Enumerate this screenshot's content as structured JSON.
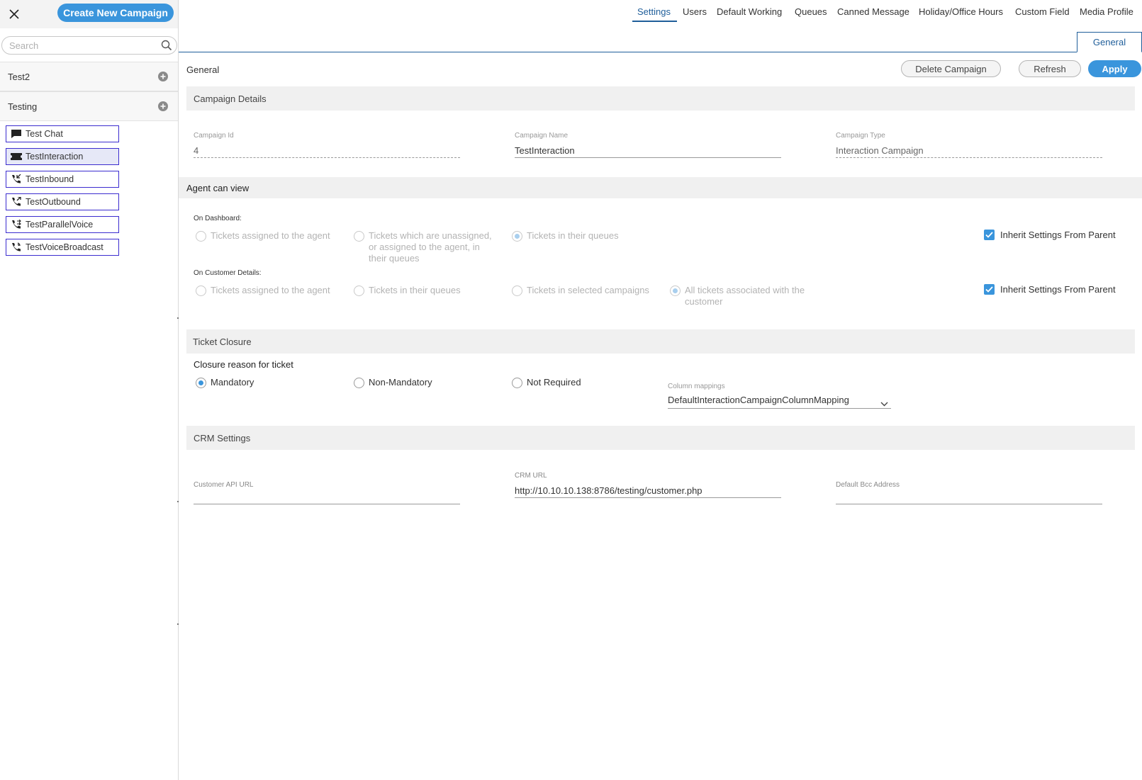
{
  "sidebar": {
    "create_label": "Create New Campaign",
    "search_placeholder": "Search",
    "groups": [
      {
        "name": "Test2"
      },
      {
        "name": "Testing"
      }
    ],
    "campaigns": [
      {
        "label": "Test Chat",
        "icon": "chat-icon"
      },
      {
        "label": "TestInteraction",
        "icon": "ticket-icon",
        "selected": true
      },
      {
        "label": "TestInbound",
        "icon": "phone-inbound-icon"
      },
      {
        "label": "TestOutbound",
        "icon": "phone-outbound-icon"
      },
      {
        "label": "TestParallelVoice",
        "icon": "phone-parallel-icon"
      },
      {
        "label": "TestVoiceBroadcast",
        "icon": "phone-broadcast-icon"
      }
    ]
  },
  "nav": {
    "tabs": [
      "Settings",
      "Users",
      "Default Working",
      "Queues",
      "Canned Message",
      "Holiday/Office Hours",
      "Custom Field",
      "Media Profile"
    ],
    "active": "Settings",
    "subtab": "General"
  },
  "page": {
    "title": "General",
    "delete_label": "Delete Campaign",
    "refresh_label": "Refresh",
    "apply_label": "Apply"
  },
  "campaign_details": {
    "heading": "Campaign Details",
    "id_label": "Campaign Id",
    "id_value": "4",
    "name_label": "Campaign Name",
    "name_value": "TestInteraction",
    "type_label": "Campaign Type",
    "type_value": "Interaction Campaign"
  },
  "agent_view": {
    "heading": "Agent can view",
    "dashboard_label": "On Dashboard:",
    "dashboard_options": [
      "Tickets assigned to the agent",
      "Tickets which are unassigned, or assigned to the agent, in their queues",
      "Tickets in their queues"
    ],
    "dashboard_selected": 2,
    "customer_label": "On Customer Details:",
    "customer_options": [
      "Tickets assigned to the agent",
      "Tickets in their queues",
      "Tickets in selected campaigns",
      "All tickets associated with the customer"
    ],
    "customer_selected": 3,
    "inherit_label": "Inherit Settings From Parent"
  },
  "ticket_closure": {
    "heading": "Ticket Closure",
    "subheading": "Closure reason for ticket",
    "options": [
      "Mandatory",
      "Non-Mandatory",
      "Not Required"
    ],
    "selected": 0,
    "mapping_label": "Column mappings",
    "mapping_value": "DefaultInteractionCampaignColumnMapping"
  },
  "crm": {
    "heading": "CRM Settings",
    "api_label": "Customer API URL",
    "api_value": "",
    "url_label": "CRM URL",
    "url_value": "http://10.10.10.138:8786/testing/customer.php",
    "bcc_label": "Default Bcc Address",
    "bcc_value": ""
  },
  "colors": {
    "accent": "#3a95dc",
    "nav_active": "#1f5e9a",
    "campaign_border": "#3b2ccf"
  }
}
